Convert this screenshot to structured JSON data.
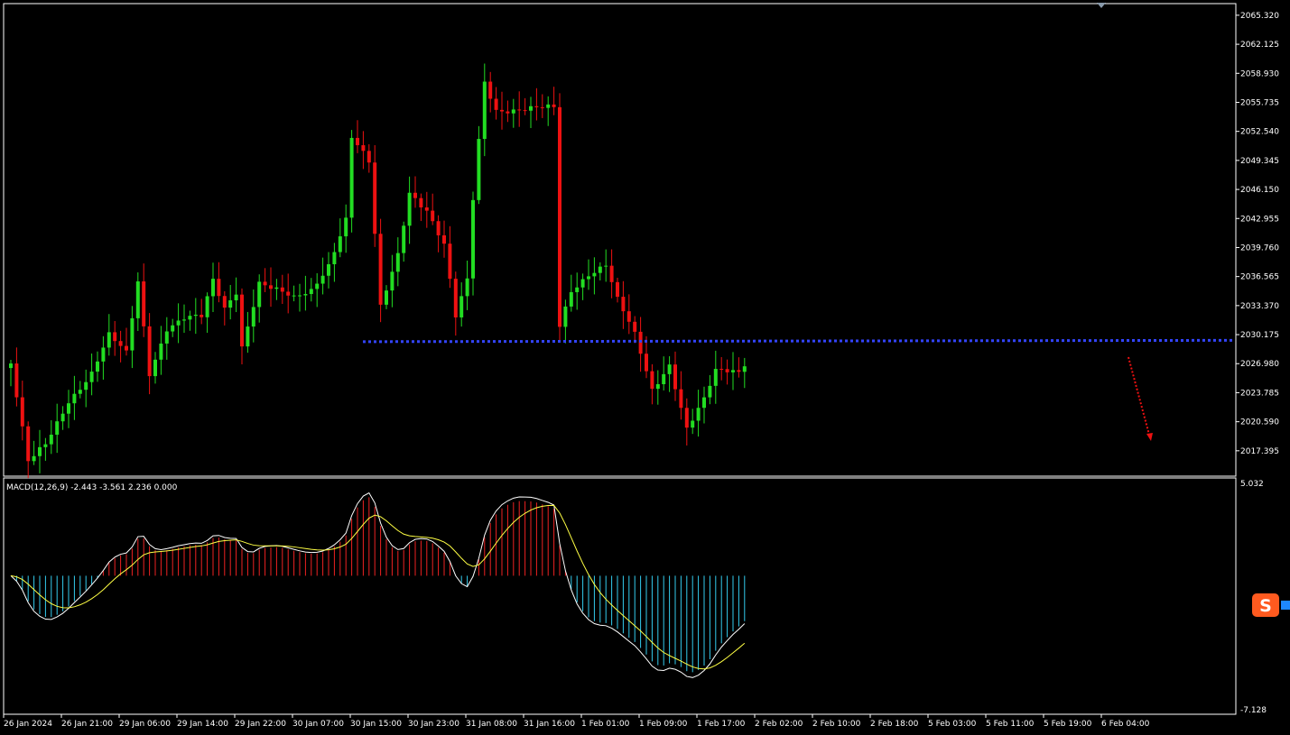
{
  "chart_data": {
    "type": "candlestick",
    "colors": {
      "background": "#000000",
      "up": "#22dd22",
      "down": "#ee1111",
      "frame": "#ffffff",
      "support": "#3344ff",
      "arrow": "#ee1111",
      "macd_line": "#ffffff",
      "signal_line": "#ffff44",
      "hist_pos": "#ee2222",
      "hist_neg": "#33ccee"
    },
    "price_axis": {
      "ticks": [
        "2065.320",
        "2062.125",
        "2058.930",
        "2055.735",
        "2052.540",
        "2049.345",
        "2046.150",
        "2042.955",
        "2039.760",
        "2036.565",
        "2033.370",
        "2030.175",
        "2026.980",
        "2023.785",
        "2020.590",
        "2017.395"
      ],
      "min": 2014.6,
      "max": 2066.6
    },
    "time_axis": [
      "26 Jan 2024",
      "26 Jan 21:00",
      "29 Jan 06:00",
      "29 Jan 14:00",
      "29 Jan 22:00",
      "30 Jan 07:00",
      "30 Jan 15:00",
      "30 Jan 23:00",
      "31 Jan 08:00",
      "31 Jan 16:00",
      "1 Feb 01:00",
      "1 Feb 09:00",
      "1 Feb 17:00",
      "2 Feb 02:00",
      "2 Feb 10:00",
      "2 Feb 18:00",
      "5 Feb 03:00",
      "5 Feb 11:00",
      "5 Feb 19:00",
      "6 Feb 04:00"
    ],
    "support_level": 2029.4,
    "macd": {
      "label": "MACD(12,26,9) -2.443 -3.561 2.236 0.000",
      "axis_top": "5.032",
      "axis_bottom": "-7.128",
      "min": -7.128,
      "max": 5.032
    },
    "anchors": [
      [
        0,
        2027
      ],
      [
        3,
        2016
      ],
      [
        6,
        2018
      ],
      [
        10,
        2023
      ],
      [
        14,
        2026
      ],
      [
        17,
        2030
      ],
      [
        20,
        2028
      ],
      [
        22,
        2036
      ],
      [
        24,
        2026
      ],
      [
        27,
        2031
      ],
      [
        30,
        2032
      ],
      [
        33,
        2032
      ],
      [
        35,
        2036
      ],
      [
        37,
        2033
      ],
      [
        39,
        2035
      ],
      [
        40,
        2029
      ],
      [
        43,
        2036
      ],
      [
        46,
        2035
      ],
      [
        49,
        2034
      ],
      [
        52,
        2035
      ],
      [
        55,
        2038
      ],
      [
        58,
        2043
      ],
      [
        59,
        2052
      ],
      [
        62,
        2049
      ],
      [
        64,
        2033
      ],
      [
        67,
        2039
      ],
      [
        69,
        2046
      ],
      [
        72,
        2044
      ],
      [
        75,
        2040
      ],
      [
        77,
        2032
      ],
      [
        79,
        2036
      ],
      [
        80,
        2045
      ],
      [
        82,
        2058
      ],
      [
        84,
        2055
      ],
      [
        88,
        2055
      ],
      [
        92,
        2055
      ],
      [
        94,
        2055
      ],
      [
        95,
        2031
      ],
      [
        97,
        2035
      ],
      [
        100,
        2037
      ],
      [
        103,
        2038
      ],
      [
        105,
        2034
      ],
      [
        108,
        2030
      ],
      [
        111,
        2024
      ],
      [
        114,
        2027
      ],
      [
        117,
        2020
      ],
      [
        120,
        2023
      ],
      [
        122,
        2026
      ],
      [
        126,
        2026
      ],
      [
        127,
        2027
      ]
    ]
  }
}
